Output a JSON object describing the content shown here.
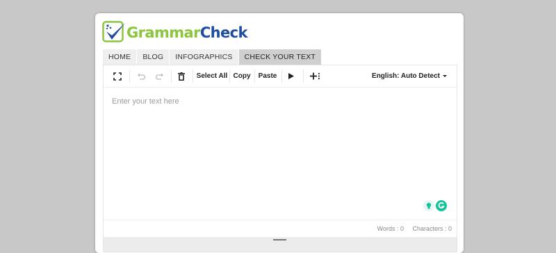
{
  "brand": {
    "word1": "Grammar",
    "word2": "Check"
  },
  "nav": {
    "tabs": [
      {
        "label": "HOME"
      },
      {
        "label": "BLOG"
      },
      {
        "label": "INFOGRAPHICS"
      },
      {
        "label": "CHECK YOUR TEXT"
      }
    ]
  },
  "toolbar": {
    "select_all": "Select All",
    "copy": "Copy",
    "paste": "Paste",
    "language": "English: Auto Detect"
  },
  "editor": {
    "placeholder": "Enter your text here"
  },
  "status": {
    "words": "Words : 0",
    "characters": "Characters : 0"
  },
  "colors": {
    "brand_green": "#8cc63f",
    "brand_blue": "#1f4e9e",
    "grammarly_green": "#15c39a"
  },
  "icons": [
    "fullscreen-icon",
    "undo-icon",
    "redo-icon",
    "trash-icon",
    "play-icon",
    "insert-icon",
    "grammarly-icon",
    "lightbulb-icon"
  ]
}
